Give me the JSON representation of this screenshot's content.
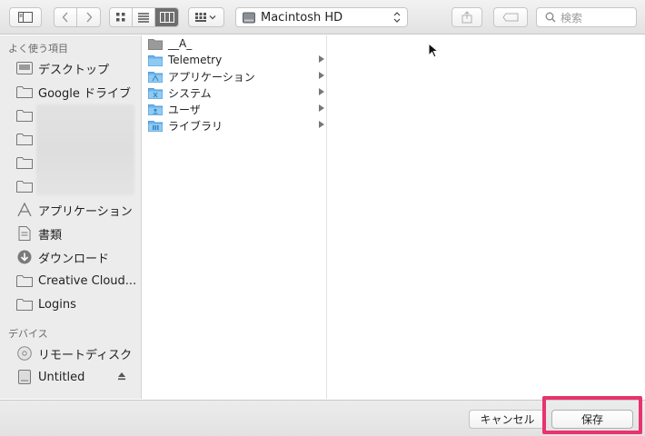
{
  "toolbar": {
    "location": "Macintosh HD",
    "search_placeholder": "検索"
  },
  "sidebar": {
    "favorites_header": "よく使う項目",
    "favorites": [
      {
        "label": "デスクトップ",
        "icon": "desktop-folder-icon"
      },
      {
        "label": "Google ドライブ",
        "icon": "folder-icon"
      },
      {
        "label": "",
        "icon": "folder-icon"
      },
      {
        "label": "",
        "icon": "folder-icon"
      },
      {
        "label": "",
        "icon": "folder-icon"
      },
      {
        "label": "",
        "icon": "folder-icon"
      },
      {
        "label": "アプリケーション",
        "icon": "applications-icon"
      },
      {
        "label": "書類",
        "icon": "document-icon"
      },
      {
        "label": "ダウンロード",
        "icon": "download-icon"
      },
      {
        "label": "Creative Cloud...",
        "icon": "folder-icon"
      },
      {
        "label": "Logins",
        "icon": "folder-icon"
      }
    ],
    "devices_header": "デバイス",
    "devices": [
      {
        "label": "リモートディスク",
        "icon": "remote-disc-icon"
      },
      {
        "label": "Untitled",
        "icon": "drive-icon"
      }
    ]
  },
  "column1": {
    "items": [
      {
        "name": "__A_",
        "icon": "gray-folder-icon",
        "has_children": false
      },
      {
        "name": "Telemetry",
        "icon": "folder-icon",
        "has_children": true
      },
      {
        "name": "アプリケーション",
        "icon": "applications-folder-icon",
        "has_children": true
      },
      {
        "name": "システム",
        "icon": "system-folder-icon",
        "has_children": true
      },
      {
        "name": "ユーザ",
        "icon": "users-folder-icon",
        "has_children": true
      },
      {
        "name": "ライブラリ",
        "icon": "library-folder-icon",
        "has_children": true
      }
    ]
  },
  "footer": {
    "cancel_label": "キャンセル",
    "save_label": "保存"
  },
  "colors": {
    "highlight": "#e8336d",
    "folder_blue": "#6cb4ec"
  }
}
